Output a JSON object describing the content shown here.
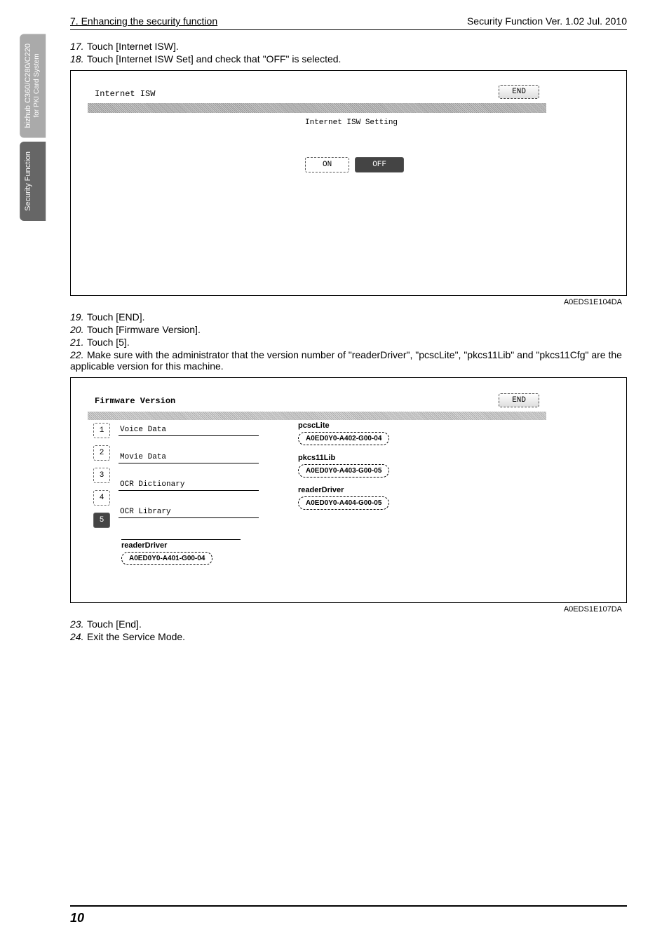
{
  "sideTabs": {
    "tab1_main": "bizhub C360/C280/C220",
    "tab1_sub": "for PKI Card System",
    "tab2": "Security Function"
  },
  "header": {
    "left": "7. Enhancing the security function",
    "right": "Security Function Ver. 1.02 Jul. 2010"
  },
  "steps_a": {
    "s17": "Touch [Internet ISW].",
    "s18": "Touch [Internet ISW Set] and check that \"OFF\" is selected."
  },
  "screen1": {
    "title": "Internet ISW",
    "end": "END",
    "subtitle": "Internet ISW Setting",
    "on": "ON",
    "off": "OFF",
    "frameId": "A0EDS1E104DA"
  },
  "steps_b": {
    "s19": "Touch [END].",
    "s20": "Touch [Firmware Version].",
    "s21": "Touch [5].",
    "s22": "Make sure with the administrator that the version number of \"readerDriver\", \"pcscLite\", \"pkcs11Lib\" and \"pkcs11Cfg\" are the applicable version for this machine."
  },
  "screen2": {
    "title": "Firmware Version",
    "end": "END",
    "pages": {
      "p1": "1",
      "p2": "2",
      "p3": "3",
      "p4": "4",
      "p5": "5"
    },
    "left": {
      "voice": "Voice Data",
      "movie": "Movie Data",
      "ocrdict": "OCR Dictionary",
      "ocrlib": "OCR Library"
    },
    "right": {
      "pcsc_name": "pcscLite",
      "pcsc_val": "A0ED0Y0-A402-G00-04",
      "pkcs_name": "pkcs11Lib",
      "pkcs_val": "A0ED0Y0-A403-G00-05",
      "rd_name": "readerDriver",
      "rd_val": "A0ED0Y0-A404-G00-05"
    },
    "overlay": {
      "rd_name": "readerDriver",
      "rd_val": "A0ED0Y0-A401-G00-04"
    },
    "frameId": "A0EDS1E107DA"
  },
  "steps_c": {
    "s23": "Touch [End].",
    "s24": "Exit the Service Mode."
  },
  "footer": {
    "page": "10"
  }
}
